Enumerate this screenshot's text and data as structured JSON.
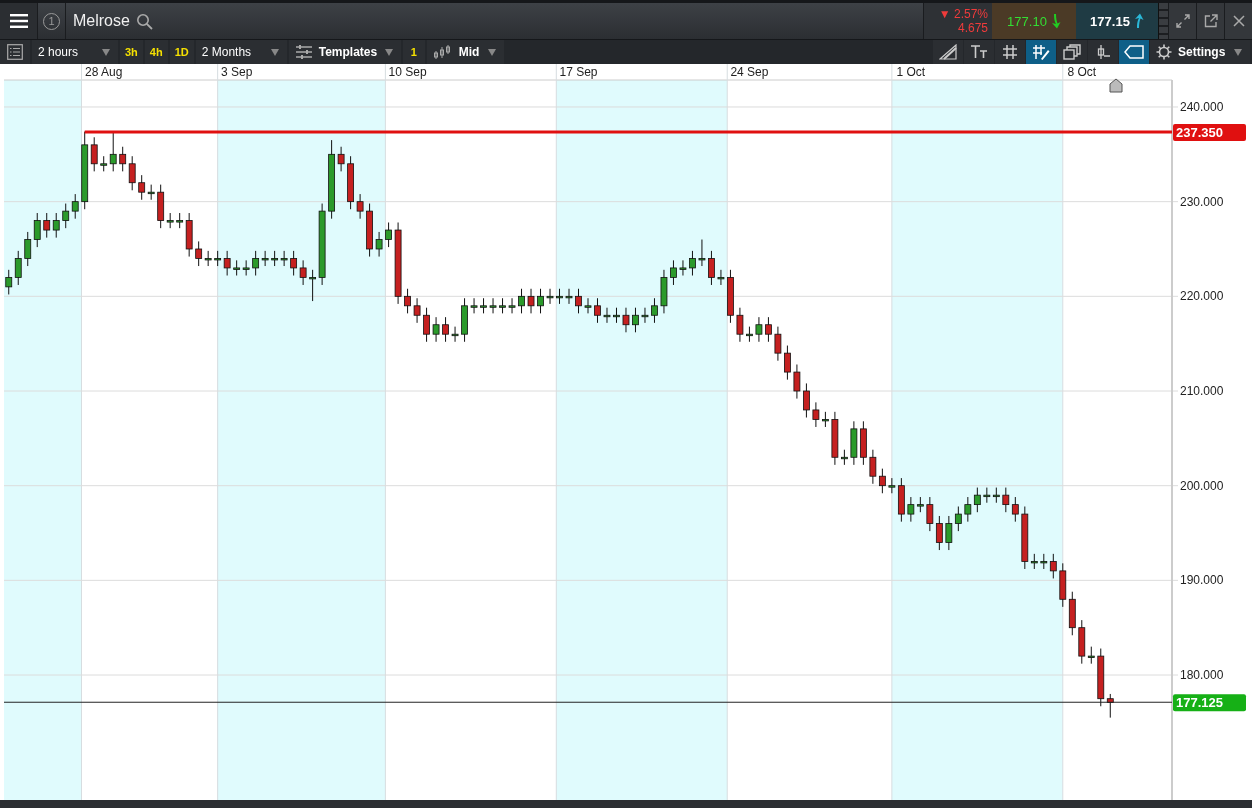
{
  "header": {
    "instrument_number": "1",
    "title": "Melrose",
    "change": {
      "arrow": "▼",
      "percent": "2.57%",
      "points": "4.675"
    },
    "sell": "177.10",
    "buy": "177.15"
  },
  "toolbar": {
    "interval": "2 hours",
    "quick_intervals": [
      {
        "label": "3h"
      },
      {
        "label": "4h"
      },
      {
        "label": "1D"
      }
    ],
    "range": "2 Months",
    "templates": "Templates",
    "count": "1",
    "price_type": "Mid",
    "tools": [
      {
        "kind": "trendline",
        "selected": false
      },
      {
        "kind": "text",
        "selected": false
      },
      {
        "kind": "grid",
        "selected": false
      },
      {
        "kind": "grid-draw",
        "selected": true
      },
      {
        "kind": "layers",
        "selected": false
      },
      {
        "kind": "candle",
        "selected": false
      },
      {
        "kind": "tag",
        "selected": true
      }
    ],
    "settings": "Settings"
  },
  "chart": {
    "chart_data": {
      "type": "candlestick",
      "ylim": [
        166.8,
        242.85
      ],
      "grid": true,
      "categories": [
        null,
        null,
        null,
        null,
        null,
        null,
        null,
        null,
        null,
        null,
        "28 Aug",
        null,
        null,
        null,
        null,
        null,
        null,
        null,
        null,
        null,
        null,
        null,
        null,
        null,
        "3 Sep",
        null,
        null,
        null,
        null,
        null,
        null,
        null,
        null,
        null,
        null,
        null,
        null,
        null,
        null,
        null,
        null,
        null,
        "10 Sep",
        null,
        null,
        null,
        null,
        null,
        null,
        null,
        null,
        null,
        null,
        null,
        null,
        null,
        null,
        null,
        null,
        null,
        "17 Sep",
        null,
        null,
        null,
        null,
        null,
        null,
        null,
        null,
        null,
        null,
        null,
        null,
        null,
        null,
        null,
        null,
        null,
        "24 Sep",
        null,
        null,
        null,
        null,
        null,
        null,
        null,
        null,
        null,
        null,
        null,
        null,
        null,
        null,
        null,
        null,
        "1 Oct",
        null,
        null,
        null,
        null,
        null,
        null,
        null,
        null,
        null,
        null,
        null,
        null,
        null,
        null,
        null,
        null,
        null,
        "8 Oct",
        null,
        null,
        null,
        null,
        null,
        null,
        null,
        null,
        null
      ],
      "yticks": [
        {
          "value": 240,
          "label": "240.000"
        },
        {
          "value": 230,
          "label": "230.000"
        },
        {
          "value": 220,
          "label": "220.000"
        },
        {
          "value": 210,
          "label": "210.000"
        },
        {
          "value": 200,
          "label": "200.000"
        },
        {
          "value": 190,
          "label": "190.000"
        },
        {
          "value": 180,
          "label": "180.000"
        }
      ],
      "ohlc": [
        [
          221,
          222.8,
          220.2,
          222
        ],
        [
          222,
          224.8,
          221.2,
          224
        ],
        [
          224,
          226.8,
          223.2,
          226
        ],
        [
          226,
          228.8,
          225.2,
          228
        ],
        [
          228,
          228.8,
          226.2,
          227
        ],
        [
          227,
          228.8,
          226.2,
          228
        ],
        [
          228,
          229.8,
          227.2,
          229
        ],
        [
          229,
          230.8,
          228.2,
          230
        ],
        [
          230,
          237.4,
          229.2,
          236
        ],
        [
          236,
          236.8,
          233.2,
          234
        ],
        [
          234,
          234.8,
          233.2,
          234
        ],
        [
          234,
          237.3,
          233.2,
          235
        ],
        [
          235,
          235.8,
          233.2,
          234
        ],
        [
          234,
          234.8,
          231.2,
          232
        ],
        [
          232,
          232.8,
          230.2,
          231
        ],
        [
          231,
          231.8,
          230.2,
          231
        ],
        [
          231,
          231.8,
          227.2,
          228
        ],
        [
          228,
          228.8,
          227.2,
          228
        ],
        [
          228,
          228.8,
          227.2,
          228
        ],
        [
          228,
          228.8,
          224.2,
          225
        ],
        [
          225,
          225.8,
          223.2,
          224
        ],
        [
          224,
          224.8,
          223.2,
          224
        ],
        [
          224,
          224.8,
          223.2,
          224
        ],
        [
          224,
          224.8,
          222.2,
          223
        ],
        [
          223,
          223.8,
          222.2,
          223
        ],
        [
          223,
          223.8,
          222.2,
          223
        ],
        [
          223,
          224.8,
          222.2,
          224
        ],
        [
          224,
          224.8,
          223.2,
          224
        ],
        [
          224,
          224.8,
          223.2,
          224
        ],
        [
          224,
          224.8,
          223.2,
          224
        ],
        [
          224,
          224.8,
          222.2,
          223
        ],
        [
          223,
          223.8,
          221.2,
          222
        ],
        [
          222,
          222.8,
          219.5,
          222
        ],
        [
          222,
          229.8,
          221.2,
          229
        ],
        [
          229,
          236.5,
          228.2,
          235
        ],
        [
          235,
          235.8,
          233.2,
          234
        ],
        [
          234,
          234.8,
          229.2,
          230
        ],
        [
          230,
          230.8,
          228.2,
          229
        ],
        [
          229,
          229.8,
          224.2,
          225
        ],
        [
          225,
          226.8,
          224.2,
          226
        ],
        [
          226,
          227.8,
          225.2,
          227
        ],
        [
          227,
          227.8,
          219.2,
          220
        ],
        [
          220,
          220.8,
          218.2,
          219
        ],
        [
          219,
          219.8,
          217.2,
          218
        ],
        [
          218,
          218.8,
          215.2,
          216
        ],
        [
          216,
          217.8,
          215.2,
          217
        ],
        [
          217,
          217.8,
          215.2,
          216
        ],
        [
          216,
          216.8,
          215.2,
          216
        ],
        [
          216,
          219.8,
          215.2,
          219
        ],
        [
          219,
          219.8,
          218.2,
          219
        ],
        [
          219,
          219.8,
          218.2,
          219
        ],
        [
          219,
          219.8,
          218.2,
          219
        ],
        [
          219,
          219.8,
          218.2,
          219
        ],
        [
          219,
          219.8,
          218.2,
          219
        ],
        [
          219,
          220.8,
          218.2,
          220
        ],
        [
          220,
          220.8,
          218.2,
          219
        ],
        [
          219,
          220.8,
          218.2,
          220
        ],
        [
          220,
          220.8,
          219.2,
          220
        ],
        [
          220,
          220.8,
          219.2,
          220
        ],
        [
          220,
          220.8,
          219.2,
          220
        ],
        [
          220,
          220.8,
          218.2,
          219
        ],
        [
          219,
          219.8,
          218.2,
          219
        ],
        [
          219,
          219.8,
          217.2,
          218
        ],
        [
          218,
          218.8,
          217.2,
          218
        ],
        [
          218,
          218.8,
          217.2,
          218
        ],
        [
          218,
          218.8,
          216.2,
          217
        ],
        [
          217,
          218.8,
          216.2,
          218
        ],
        [
          218,
          218.8,
          217.2,
          218
        ],
        [
          218,
          219.8,
          217.2,
          219
        ],
        [
          219,
          222.8,
          218.2,
          222
        ],
        [
          222,
          223.8,
          221.2,
          223
        ],
        [
          223,
          223.8,
          222.2,
          223
        ],
        [
          223,
          224.8,
          222.2,
          224
        ],
        [
          224,
          226,
          223.2,
          224
        ],
        [
          224,
          224.8,
          221.2,
          222
        ],
        [
          222,
          222.8,
          221.2,
          222
        ],
        [
          222,
          222.8,
          217.2,
          218
        ],
        [
          218,
          218.8,
          215.2,
          216
        ],
        [
          216,
          216.8,
          215.2,
          216
        ],
        [
          216,
          217.8,
          215.2,
          217
        ],
        [
          217,
          217.8,
          215.2,
          216
        ],
        [
          216,
          216.8,
          213.2,
          214
        ],
        [
          214,
          214.8,
          211.2,
          212
        ],
        [
          212,
          212.8,
          209.2,
          210
        ],
        [
          210,
          210.8,
          207.2,
          208
        ],
        [
          208,
          208.8,
          206.2,
          207
        ],
        [
          207,
          207.8,
          206.2,
          207
        ],
        [
          207,
          207.8,
          202.2,
          203
        ],
        [
          203,
          203.8,
          202.2,
          203
        ],
        [
          203,
          206.8,
          202.2,
          206
        ],
        [
          206,
          206.8,
          202.2,
          203
        ],
        [
          203,
          203.8,
          200.2,
          201
        ],
        [
          201,
          201.8,
          199.2,
          200
        ],
        [
          200,
          200.8,
          199.2,
          200
        ],
        [
          200,
          200.8,
          196.2,
          197
        ],
        [
          197,
          198.8,
          196.2,
          198
        ],
        [
          198,
          198.8,
          197.2,
          198
        ],
        [
          198,
          198.8,
          195.2,
          196
        ],
        [
          196,
          196.8,
          193.2,
          194
        ],
        [
          194,
          196.8,
          193.2,
          196
        ],
        [
          196,
          197.8,
          195.2,
          197
        ],
        [
          197,
          198.8,
          196.2,
          198
        ],
        [
          198,
          199.8,
          197.2,
          199
        ],
        [
          199,
          199.8,
          198.2,
          199
        ],
        [
          199,
          199.8,
          198.2,
          199
        ],
        [
          199,
          199.8,
          197.2,
          198
        ],
        [
          198,
          198.8,
          196.2,
          197
        ],
        [
          197,
          197.8,
          191.2,
          192
        ],
        [
          192,
          192.8,
          191.2,
          192
        ],
        [
          192,
          192.8,
          191.2,
          192
        ],
        [
          192,
          192.8,
          190.2,
          191
        ],
        [
          191,
          191.8,
          187.2,
          188
        ],
        [
          188,
          188.8,
          184.2,
          185
        ],
        [
          185,
          185.8,
          181.2,
          182
        ],
        [
          182,
          183,
          181.2,
          182
        ],
        [
          182,
          182.8,
          176.7,
          177.5
        ],
        [
          177.5,
          178,
          175.5,
          177.1
        ],
        null,
        null,
        null,
        null,
        null,
        null
      ],
      "ref_lines": [
        {
          "axis": "y",
          "value": 237.35,
          "label": "237.350",
          "color": "#e01010"
        },
        {
          "axis": "y",
          "value": 177.125,
          "label": "177.125",
          "color": "#222222"
        }
      ]
    }
  }
}
